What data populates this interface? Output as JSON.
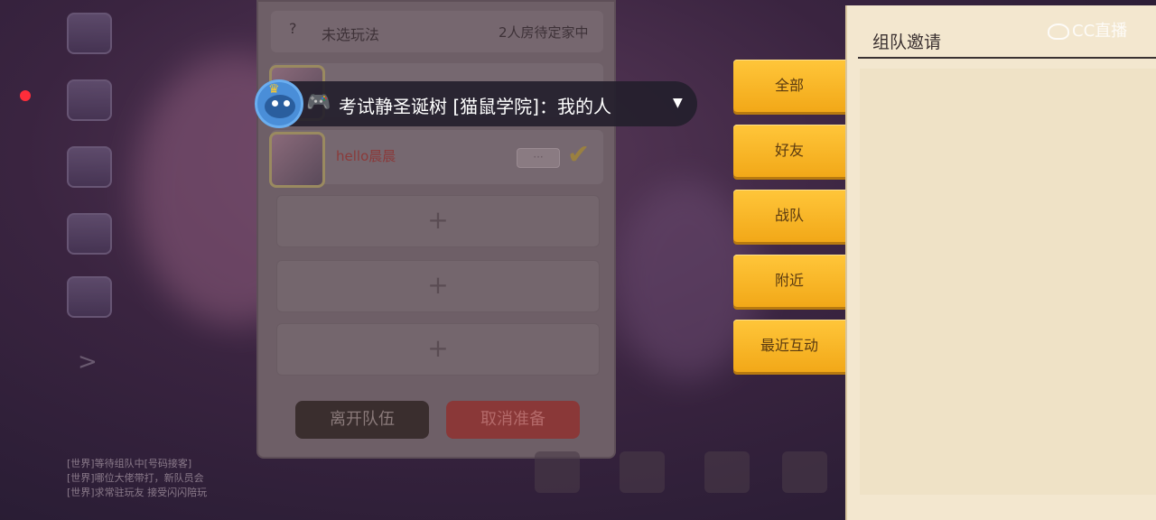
{
  "watermark": "CC直播",
  "team_panel": {
    "mode_label": "未选玩法",
    "mode_status": "2人房待定家中",
    "player_name": "hello晨晨",
    "player_badge": "···",
    "empty_slot_glyph": "+",
    "leave_button": "离开队伍",
    "cancel_ready_button": "取消准备"
  },
  "chat_notification": {
    "message": "考试静圣诞树 [猫鼠学院]：我的人",
    "game_icon": "gamepad-icon"
  },
  "tabs": [
    "全部",
    "好友",
    "战队",
    "附近",
    "最近互动"
  ],
  "invite_panel": {
    "title": "组队邀请"
  },
  "chat_log": {
    "lines": [
      "[世界]等待组队中[号码接客]",
      "[世界]哪位大佬带打，新队员会",
      "[世界]求常驻玩友 接受闪闪陪玩"
    ]
  },
  "colors": {
    "tab_gold": "#ffc63a",
    "parchment": "#f3e7cf",
    "cancel_red": "#8a3838"
  }
}
